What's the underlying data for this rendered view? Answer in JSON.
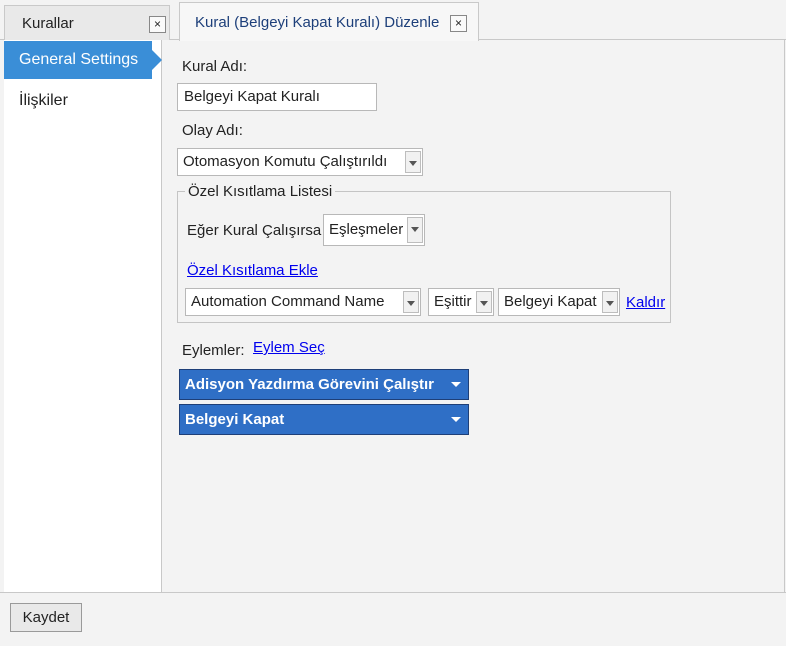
{
  "tabs": [
    {
      "label": "Kurallar",
      "close": "×"
    },
    {
      "label": "Kural (Belgeyi Kapat Kuralı) Düzenle",
      "close": "×"
    }
  ],
  "sidebar": {
    "items": [
      {
        "label": "General Settings"
      },
      {
        "label": "İlişkiler"
      }
    ]
  },
  "form": {
    "rule_name_label": "Kural Adı:",
    "rule_name_value": "Belgeyi Kapat Kuralı",
    "event_name_label": "Olay Adı:",
    "event_name_value": "Otomasyon Komutu Çalıştırıldı",
    "constraints": {
      "legend": "Özel Kısıtlama Listesi",
      "if_rule_runs_label": "Eğer Kural Çalışırsa",
      "match_value": "Eşleşmeler",
      "add_constraint_link": "Özel Kısıtlama Ekle",
      "row": {
        "field": "Automation Command Name",
        "operator": "Eşittir",
        "value": "Belgeyi Kapat",
        "remove_link": "Kaldır"
      }
    },
    "actions_label": "Eylemler:",
    "select_action_link": "Eylem Seç",
    "actions": [
      {
        "label": "Adisyon Yazdırma Görevini Çalıştır"
      },
      {
        "label": "Belgeyi Kapat"
      }
    ]
  },
  "footer": {
    "save_label": "Kaydet"
  },
  "colors": {
    "accent": "#3a8ed7",
    "action_bar": "#2f6fc6",
    "link": "#0000ee"
  }
}
